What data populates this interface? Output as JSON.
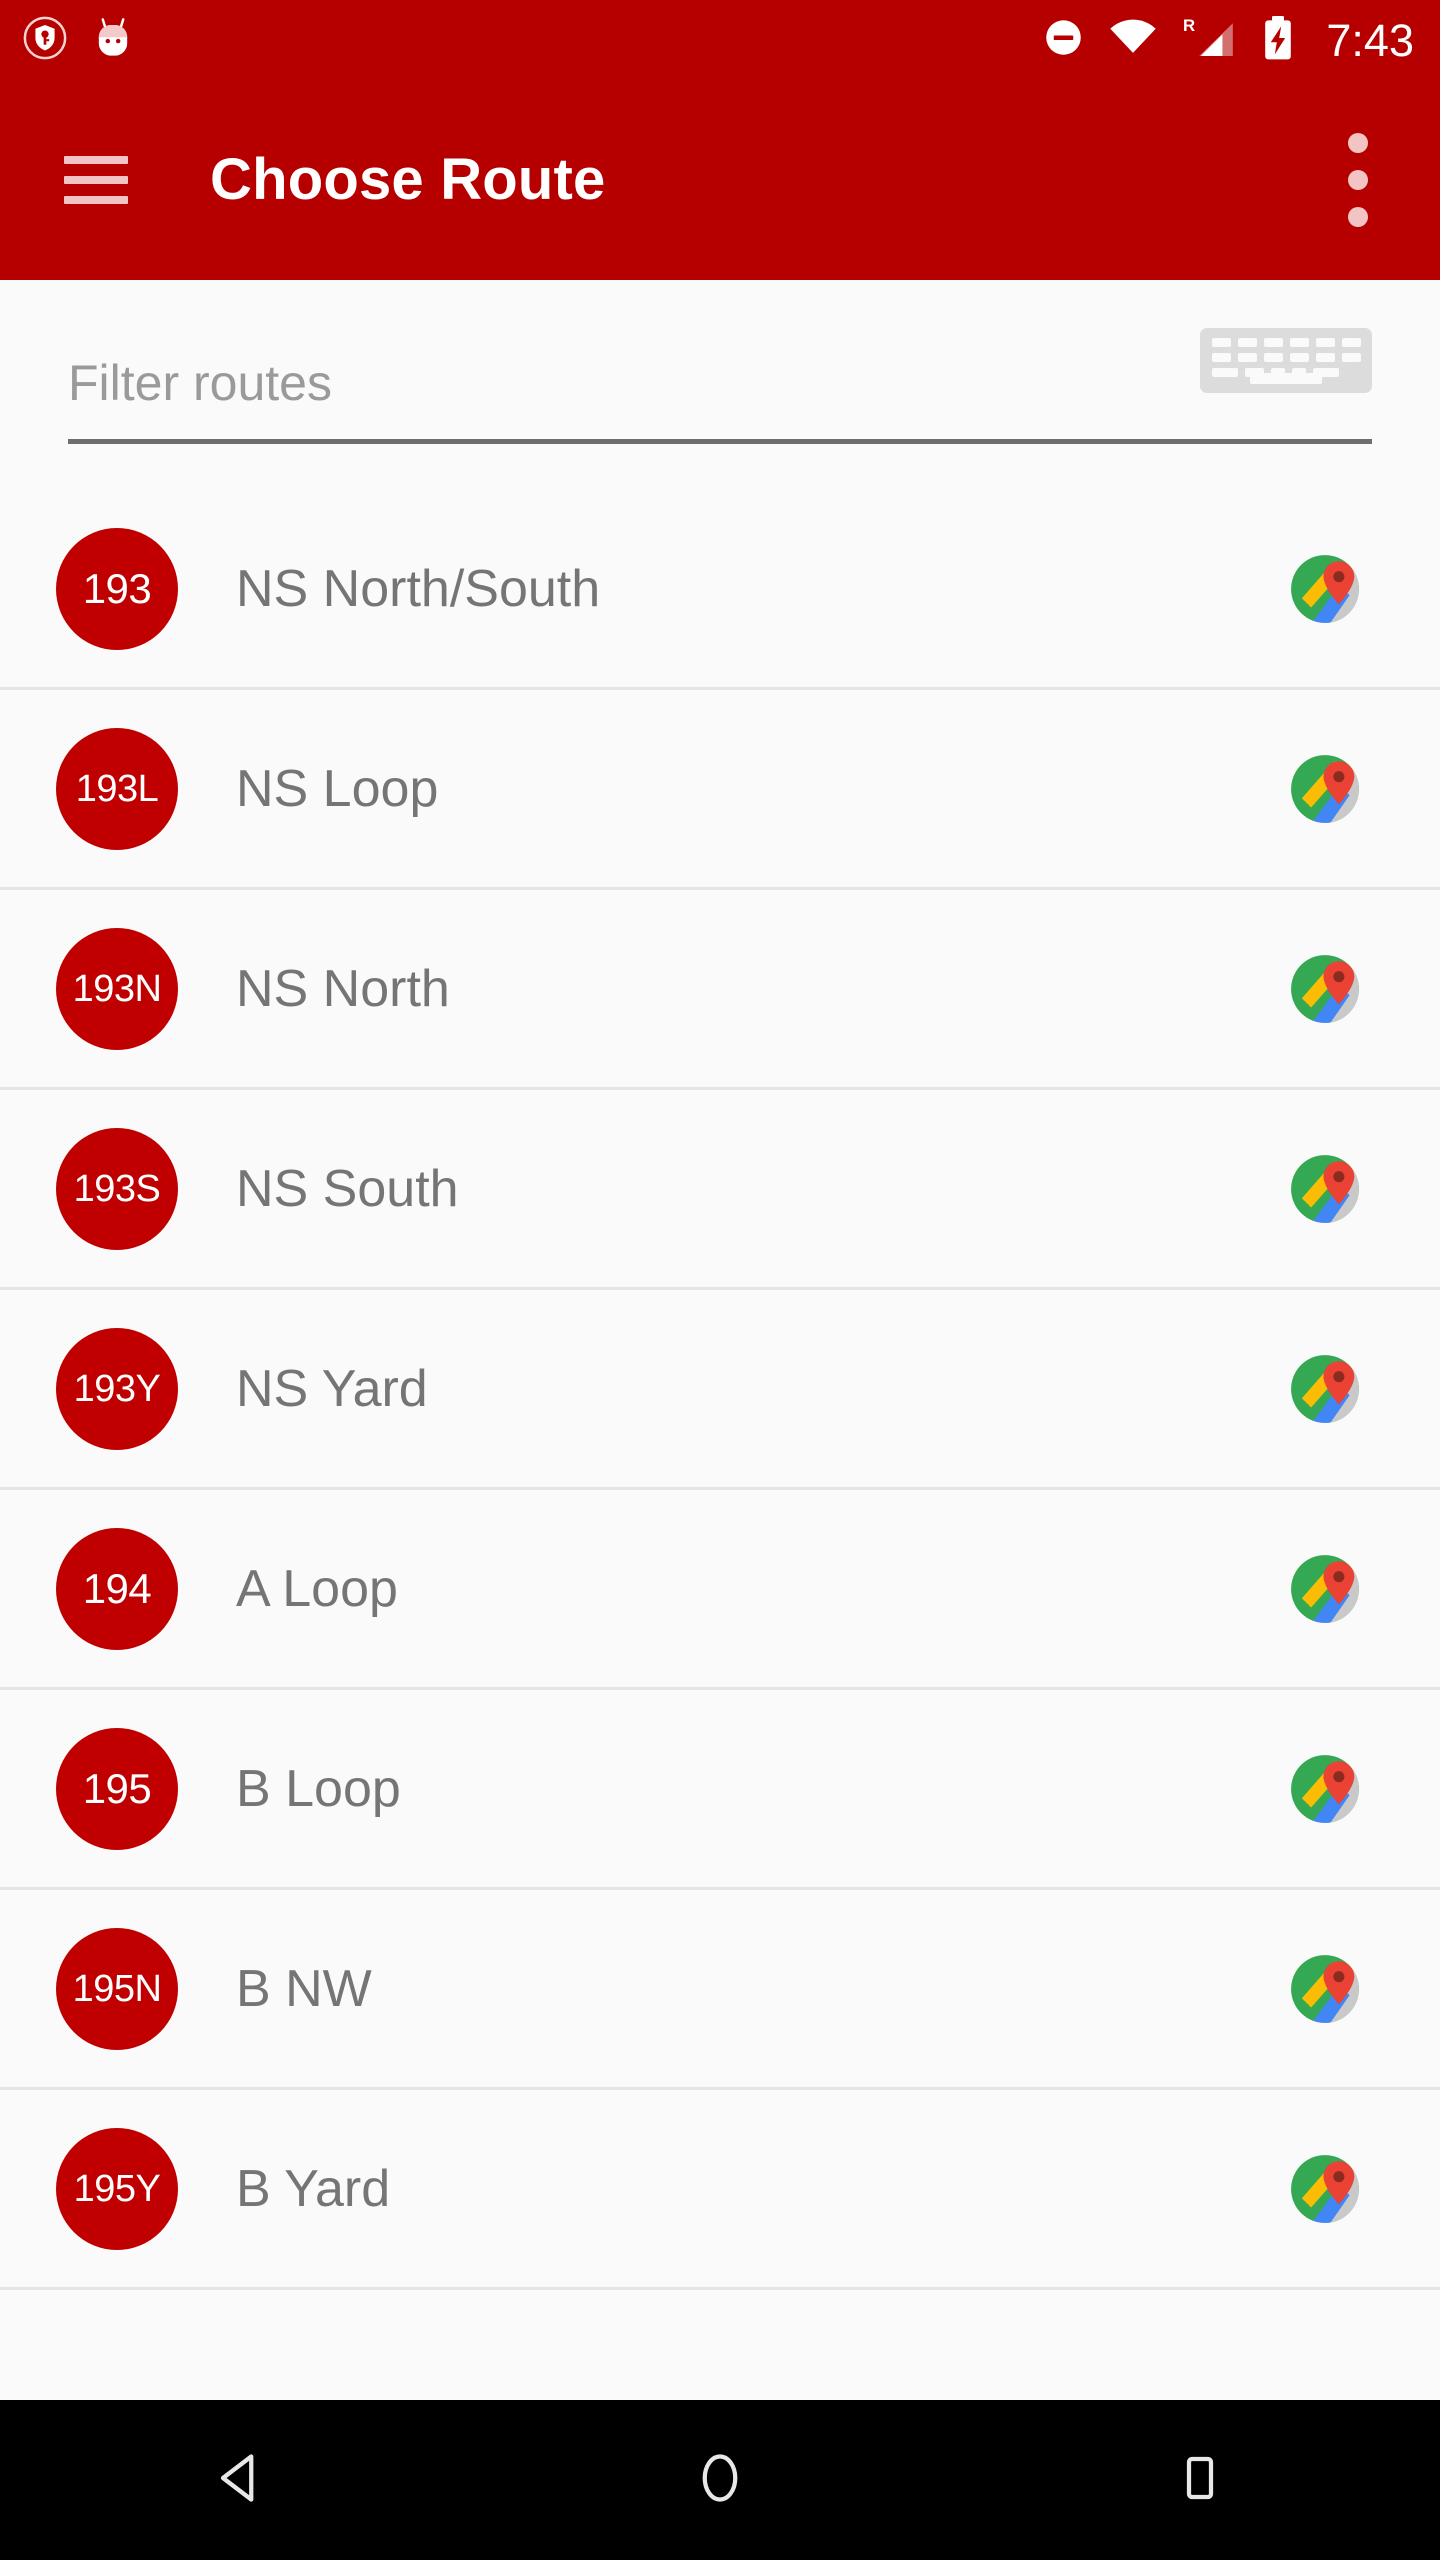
{
  "status_bar": {
    "time": "7:43",
    "left_icons": [
      {
        "name": "vpn-key-shield-icon"
      },
      {
        "name": "android-head-icon"
      }
    ],
    "right_icons": [
      {
        "name": "do-not-disturb-icon"
      },
      {
        "name": "wifi-icon"
      },
      {
        "name": "roaming-signal-icon",
        "label": "R"
      },
      {
        "name": "battery-charging-icon"
      }
    ],
    "background_color": "#b60000"
  },
  "app_bar": {
    "title": "Choose Route",
    "menu_icon": "hamburger-menu-icon",
    "overflow_icon": "overflow-menu-icon",
    "background_color": "#b60000",
    "title_color": "#ffffff"
  },
  "filter": {
    "value": "",
    "placeholder": "Filter routes",
    "keyboard_button_icon": "keyboard-icon"
  },
  "routes": [
    {
      "badge": "193",
      "name": "NS North/South",
      "map_icon": "google-maps-icon"
    },
    {
      "badge": "193L",
      "name": "NS Loop",
      "map_icon": "google-maps-icon"
    },
    {
      "badge": "193N",
      "name": "NS North",
      "map_icon": "google-maps-icon"
    },
    {
      "badge": "193S",
      "name": "NS South",
      "map_icon": "google-maps-icon"
    },
    {
      "badge": "193Y",
      "name": "NS Yard",
      "map_icon": "google-maps-icon"
    },
    {
      "badge": "194",
      "name": "A Loop",
      "map_icon": "google-maps-icon"
    },
    {
      "badge": "195",
      "name": "B Loop",
      "map_icon": "google-maps-icon"
    },
    {
      "badge": "195N",
      "name": "B NW",
      "map_icon": "google-maps-icon"
    },
    {
      "badge": "195Y",
      "name": "B Yard",
      "map_icon": "google-maps-icon"
    }
  ],
  "colors": {
    "brand_red": "#b60000",
    "badge_red": "#c00000",
    "page_background": "#fafafa",
    "divider": "#e4e4e4",
    "route_text": "#757575",
    "placeholder_text": "#9a9a9a",
    "nav_bar": "#000000"
  },
  "nav_bar": {
    "buttons": [
      {
        "name": "back-button",
        "icon": "back-triangle-icon"
      },
      {
        "name": "home-button",
        "icon": "home-circle-icon"
      },
      {
        "name": "recents-button",
        "icon": "recents-square-icon"
      }
    ]
  }
}
